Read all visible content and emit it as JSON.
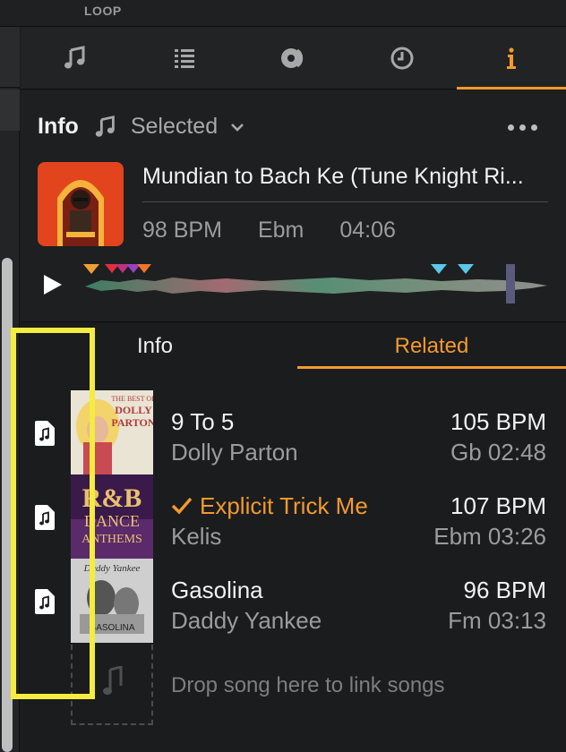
{
  "top": {
    "loop_label": "LOOP"
  },
  "tabs": [
    {
      "icon": "music-note-icon",
      "active": false
    },
    {
      "icon": "list-icon",
      "active": false
    },
    {
      "icon": "vinyl-record-icon",
      "active": false
    },
    {
      "icon": "clock-icon",
      "active": false
    },
    {
      "icon": "info-icon",
      "active": true
    }
  ],
  "info": {
    "title": "Info",
    "selected_label": "Selected",
    "track": {
      "title": "Mundian to Bach Ke (Tune Knight Ri...",
      "bpm": "98 BPM",
      "key": "Ebm",
      "duration": "04:06"
    }
  },
  "subtabs": {
    "info": "Info",
    "related": "Related",
    "active": "Related"
  },
  "related": [
    {
      "title": "9 To 5",
      "artist": "Dolly Parton",
      "bpm": "105 BPM",
      "key_time": "Gb 02:48",
      "playing": false
    },
    {
      "title": "Explicit Trick Me",
      "artist": "Kelis",
      "bpm": "107 BPM",
      "key_time": "Ebm 03:26",
      "playing": true
    },
    {
      "title": "Gasolina",
      "artist": "Daddy Yankee",
      "bpm": "96 BPM",
      "key_time": "Fm 03:13",
      "playing": false
    }
  ],
  "drop_text": "Drop song here to link songs",
  "colors": {
    "accent": "#f29a2e",
    "highlight": "#f4ec3f",
    "background": "#1b1c1e"
  }
}
